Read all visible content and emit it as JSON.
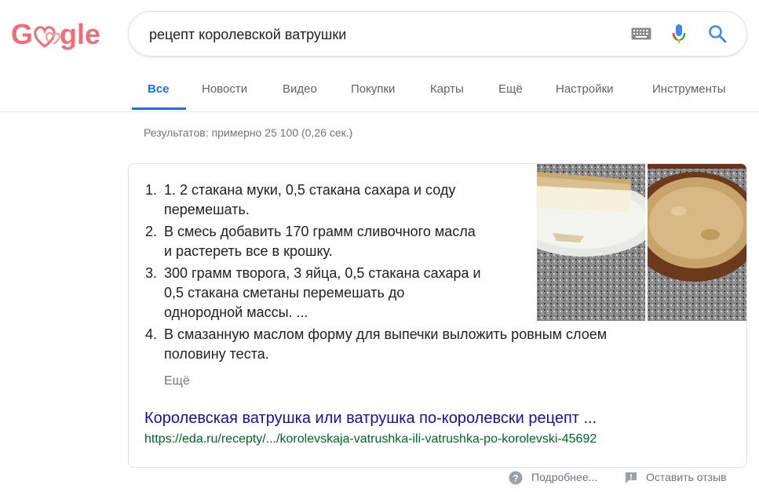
{
  "logo": {
    "letters": [
      "G",
      "♡",
      "♡",
      "g",
      "l",
      "e"
    ],
    "color": "#ee6e78"
  },
  "search": {
    "query": "рецепт королевской ватрушки"
  },
  "icons": {
    "keyboard": "keyboard-icon",
    "mic": "microphone-icon",
    "search": "search-icon",
    "help": "help-icon",
    "feedback": "feedback-icon"
  },
  "tabs": [
    {
      "label": "Все",
      "active": true
    },
    {
      "label": "Новости"
    },
    {
      "label": "Видео"
    },
    {
      "label": "Покупки"
    },
    {
      "label": "Карты"
    },
    {
      "label": "Ещё"
    },
    {
      "label": "Настройки"
    },
    {
      "label": "Инструменты"
    }
  ],
  "stats": "Результатов: примерно 25 100 (0,26 сек.)",
  "snippet": {
    "steps": [
      {
        "num": "1.",
        "lines": [
          "1. 2 стакана муки, 0,5 стакана сахара и соду",
          "перемешать."
        ]
      },
      {
        "num": "2.",
        "lines": [
          "В смесь добавить 170 грамм сливочного масла",
          "и растереть все в крошку."
        ]
      },
      {
        "num": "3.",
        "lines": [
          "300 грамм творога, 3 яйца, 0,5 стакана сахара и",
          "0,5 стакана сметаны перемешать до",
          "однородной массы. ..."
        ]
      },
      {
        "num": "4.",
        "lines": [
          "В смазанную маслом форму для выпечки выложить ровным слоем",
          "половину теста."
        ]
      }
    ],
    "more": "Ещё",
    "title": "Королевская ватрушка или ватрушка по-королевски рецепт ...",
    "url": "https://eda.ru/recepty/.../korolevskaja-vatrushka-ili-vatrushka-po-korolevski-45692"
  },
  "footer": {
    "details": "Подробнее...",
    "feedback": "Оставить отзыв"
  },
  "colors": {
    "link": "#1a0dab",
    "url": "#006621",
    "accent": "#1a73e8"
  }
}
